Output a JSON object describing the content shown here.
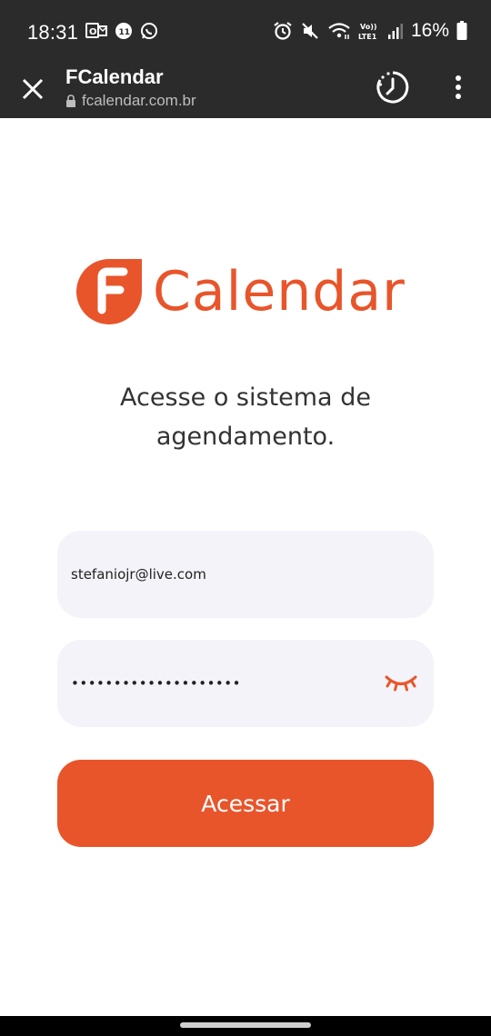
{
  "status_bar": {
    "time": "18:31",
    "battery_percent": "16%",
    "signal_label": "Vo)) LTE1",
    "left_icons": [
      "outlook-icon",
      "notification-badge-icon",
      "whatsapp-icon"
    ],
    "right_icons": [
      "alarm-icon",
      "mute-icon",
      "wifi-icon",
      "signal-icon",
      "battery-icon"
    ]
  },
  "browser": {
    "title": "FCalendar",
    "url": "fcalendar.com.br"
  },
  "logo": {
    "mark_letter": "F",
    "text": "Calendar",
    "brand_color": "#e8552b"
  },
  "heading": {
    "line1": "Acesse o sistema de",
    "line2": "agendamento."
  },
  "form": {
    "email_value": "stefaniojr@live.com",
    "password_value": "••••••••••••••••••••",
    "submit_label": "Acessar"
  },
  "colors": {
    "accent": "#e8552b",
    "field_bg": "#f3f3f9",
    "bar_bg": "#2b2b2b"
  }
}
